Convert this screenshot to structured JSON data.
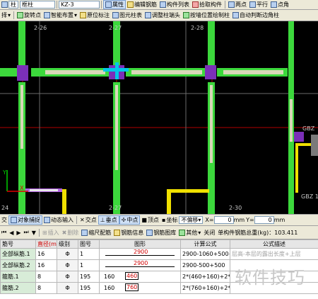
{
  "toolbar1": {
    "category": "柱",
    "type": "框柱",
    "element": "KZ-3",
    "attr": "属性",
    "edit_rebar": "编辑钢筋",
    "list": "构件列表",
    "pick": "拾取构件",
    "two_point": "两点",
    "parallel": "平行",
    "point_angle": "点角"
  },
  "toolbar2": {
    "sel": "择",
    "rotate_point": "旋转点",
    "smart_layout": "智能布置",
    "orig_label": "原位标注",
    "table": "图元柱表",
    "adjust_head": "调整柱端头",
    "draw_by_pos": "按墙位置绘制柱",
    "auto_edge": "自动判断边角柱"
  },
  "canvas": {
    "axis_labels": [
      "2-26",
      "2-27",
      "2-28",
      "2-27",
      "2-30",
      "24"
    ],
    "tag1": "GBZ",
    "tag2": "GBZ 1",
    "y_axis": "Y",
    "x_axis": "X"
  },
  "snapbar": {
    "item0": "交",
    "ortho": "对象捕捉",
    "dynamic": "动态输入",
    "intersect": "交点",
    "perp": "垂点",
    "mid": "中点",
    "top": "顶点",
    "coord": "坐标",
    "offset": "不偏移",
    "x_label": "X=",
    "x_val": "0",
    "x_unit": "mm",
    "y_label": "Y=",
    "y_val": "0",
    "y_unit": "mm"
  },
  "rebarbar": {
    "insert": "插入",
    "delete": "删除",
    "scale": "缩尺配筋",
    "info": "钢筋信息",
    "lib": "钢筋图库",
    "other": "其他",
    "close": "关闭",
    "weight": "单构件钢筋总重(kg)：103.411"
  },
  "table": {
    "headers": [
      "筋号",
      "直径(mm)",
      "级别",
      "图号",
      "图形",
      "计算公式",
      "公式描述"
    ],
    "rows": [
      {
        "name": "全部纵筋.1",
        "dia": "16",
        "grade": "Φ",
        "fig": "1",
        "shape_val": "2900",
        "formula": "2900-1060+500+1*max(",
        "desc": "层高-本层的露出长度+上层"
      },
      {
        "name": "全部纵筋.2",
        "dia": "16",
        "grade": "Φ",
        "fig": "1",
        "shape_val": "2900",
        "formula": "2900-500+500",
        "desc": ""
      },
      {
        "name": "箍筋.1",
        "dia": "8",
        "grade": "Φ",
        "fig": "195",
        "shape_val": "160",
        "shape_val2": "460",
        "formula": "2*(460+160)+2*(11",
        "desc": ""
      },
      {
        "name": "箍筋.2",
        "dia": "8",
        "grade": "Φ",
        "fig": "195",
        "shape_val": "160",
        "shape_val2": "760",
        "formula": "2*(760+160)+2*(11",
        "desc": ""
      }
    ]
  },
  "watermark": "软件技巧"
}
